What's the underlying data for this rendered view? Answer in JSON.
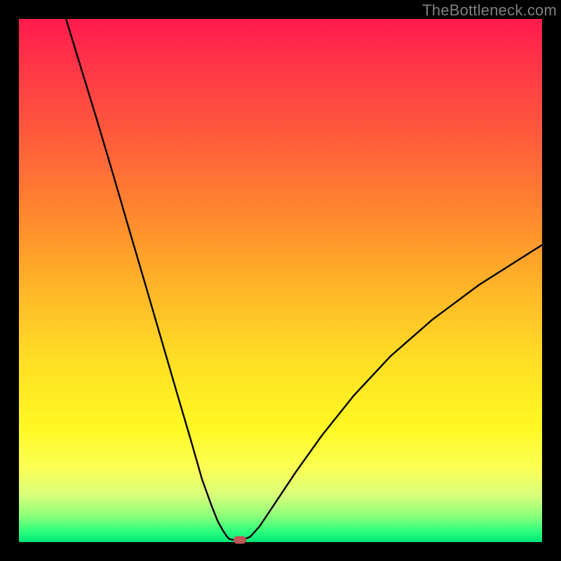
{
  "watermark": "TheBottleneck.com",
  "chart_data": {
    "type": "line",
    "title": "",
    "xlabel": "",
    "ylabel": "",
    "xlim": [
      0,
      100
    ],
    "ylim": [
      0,
      100
    ],
    "grid": false,
    "series": [
      {
        "name": "curve-left",
        "x": [
          9.0,
          12,
          15,
          18,
          21,
          24,
          27,
          30,
          33,
          35,
          36.8,
          38.0,
          39.0,
          39.8,
          40.2
        ],
        "y": [
          100,
          90.2,
          80.4,
          70.3,
          60.0,
          49.8,
          39.5,
          29.2,
          19.0,
          12.0,
          7.0,
          4.0,
          2.2,
          1.0,
          0.6
        ]
      },
      {
        "name": "curve-bottom",
        "x": [
          40.2,
          41.0,
          42.0,
          43.2,
          44.2
        ],
        "y": [
          0.6,
          0.4,
          0.4,
          0.6,
          1.0
        ]
      },
      {
        "name": "curve-right",
        "x": [
          44.2,
          46,
          49,
          53,
          58,
          64,
          71,
          79,
          88,
          100
        ],
        "y": [
          1.0,
          3.0,
          7.5,
          13.5,
          20.5,
          28.0,
          35.5,
          42.5,
          49.2,
          56.8
        ]
      }
    ],
    "marker": {
      "x": 42.2,
      "y": 0.4
    },
    "background_gradient": {
      "top": "#ff1a4d",
      "bottom": "#00e57a"
    }
  }
}
